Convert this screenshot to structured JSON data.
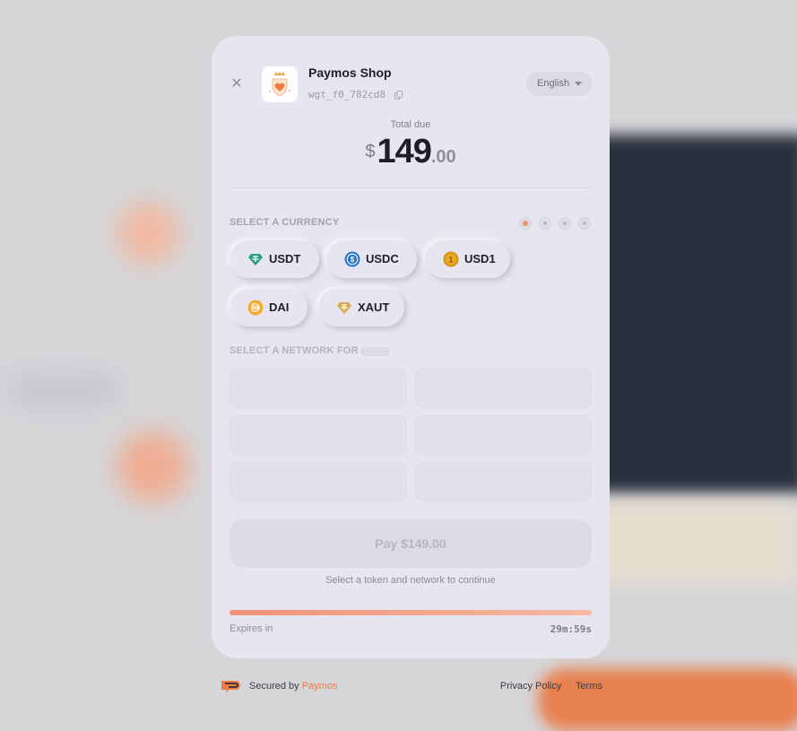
{
  "shop": {
    "name": "Paymos Shop",
    "widget_id": "wgt_f0_782cd8"
  },
  "language": {
    "selected": "English"
  },
  "total": {
    "label": "Total due",
    "currency_symbol": "$",
    "whole": "149",
    "decimal": ".00"
  },
  "currency_section": {
    "label": "SELECT A CURRENCY",
    "step_total": 4,
    "step_active": 1
  },
  "currencies": [
    {
      "label": "USDT",
      "icon": "usdt-icon",
      "color": "#26a17b"
    },
    {
      "label": "USDC",
      "icon": "usdc-icon",
      "color": "#2775ca"
    },
    {
      "label": "USD1",
      "icon": "usd1-icon",
      "color": "#d4920d"
    },
    {
      "label": "DAI",
      "icon": "dai-icon",
      "color": "#f5ac37"
    },
    {
      "label": "XAUT",
      "icon": "xaut-icon",
      "color": "#d6a84f"
    }
  ],
  "network_section": {
    "label": "SELECT A NETWORK FOR"
  },
  "pay": {
    "label": "Pay $149.00",
    "hint": "Select a token and network to continue"
  },
  "timer": {
    "label": "Expires in",
    "value": "29m:59s",
    "remaining_fraction": 1.0
  },
  "footer": {
    "secured_prefix": "Secured by",
    "brand": "Paymos",
    "privacy": "Privacy Policy",
    "separator": "·",
    "terms": "Terms"
  },
  "colors": {
    "accent": "#ec7c48",
    "card": "#e7e5ef",
    "text": "#1c1f2a"
  }
}
